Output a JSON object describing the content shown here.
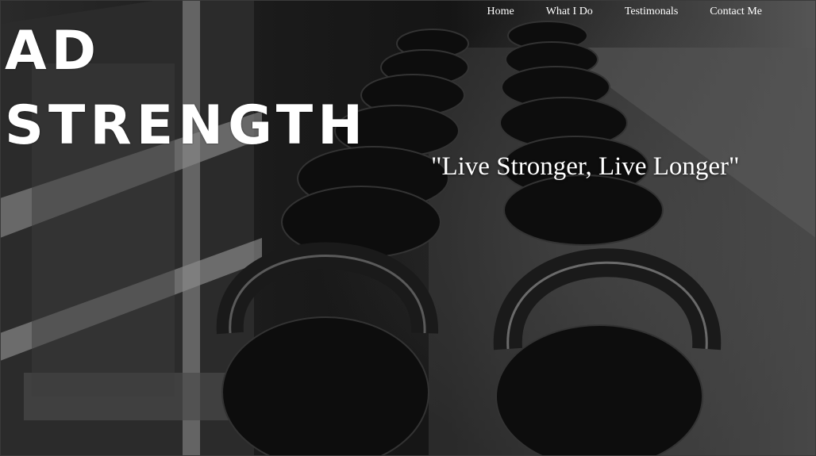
{
  "nav": {
    "items": [
      {
        "label": "Home"
      },
      {
        "label": "What I Do"
      },
      {
        "label": "Testimonals"
      },
      {
        "label": "Contact Me"
      }
    ]
  },
  "brand": {
    "line1": "AD",
    "line2": "STRENGTH"
  },
  "tagline": "\"Live Stronger, Live Longer\"",
  "colors": {
    "text": "#ffffff",
    "background": "#000000"
  },
  "background": {
    "image_icon": "kettlebell-rack-photo"
  }
}
